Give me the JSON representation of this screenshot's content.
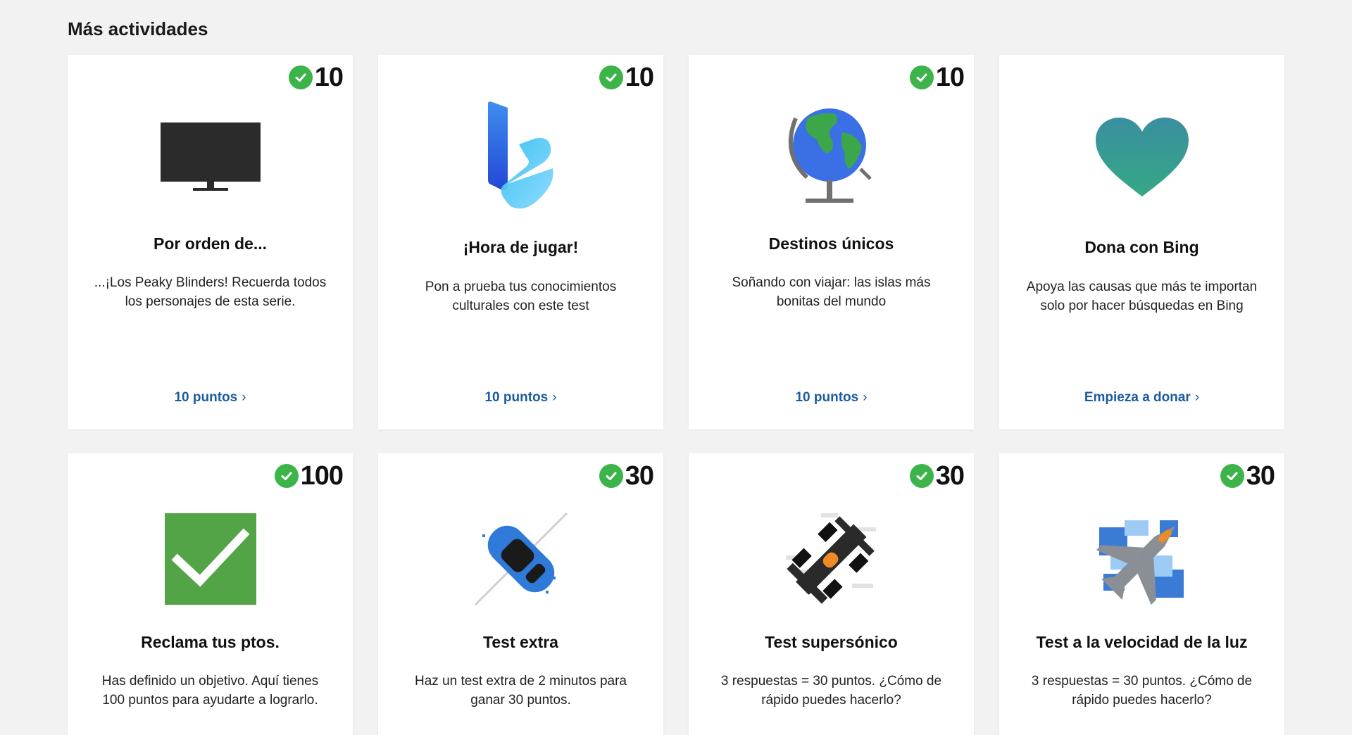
{
  "section": {
    "title": "Más actividades"
  },
  "cards": [
    {
      "points": "10",
      "title": "Por orden de...",
      "desc1": "...¡Los Peaky Blinders! Recuerda todos",
      "desc2": "los personajes de esta serie.",
      "link": "10 puntos",
      "icon": "tv-icon"
    },
    {
      "points": "10",
      "title": "¡Hora de jugar!",
      "desc1": "Pon a prueba tus conocimientos",
      "desc2": "culturales con este test",
      "link": "10 puntos",
      "icon": "bing-logo-icon"
    },
    {
      "points": "10",
      "title": "Destinos únicos",
      "desc1": "Soñando con viajar: las islas más",
      "desc2": "bonitas del mundo",
      "link": "10 puntos",
      "icon": "globe-icon"
    },
    {
      "title": "Dona con Bing",
      "desc1": "Apoya las causas que más te importan",
      "desc2": "solo por hacer búsquedas en Bing",
      "link": "Empieza a donar",
      "icon": "heart-icon"
    },
    {
      "points": "100",
      "title": "Reclama tus ptos.",
      "desc1": "Has definido un objetivo. Aquí tienes",
      "desc2": "100 puntos para ayudarte a lograrlo.",
      "icon": "checkmark-box-icon"
    },
    {
      "points": "30",
      "title": "Test extra",
      "desc1": "Haz un test extra de 2 minutos para",
      "desc2": "ganar 30 puntos.",
      "icon": "race-car-icon"
    },
    {
      "points": "30",
      "title": "Test supersónico",
      "desc1": "3 respuestas = 30 puntos. ¿Cómo de",
      "desc2": "rápido puedes hacerlo?",
      "icon": "formula-car-icon"
    },
    {
      "points": "30",
      "title": "Test a la velocidad de la luz",
      "desc1": "3 respuestas = 30 puntos. ¿Cómo de",
      "desc2": "rápido puedes hacerlo?",
      "icon": "jet-icon"
    }
  ],
  "colors": {
    "accent_link": "#1c5c9e",
    "check_green": "#3cb44a",
    "background": "#f2f2f2"
  }
}
